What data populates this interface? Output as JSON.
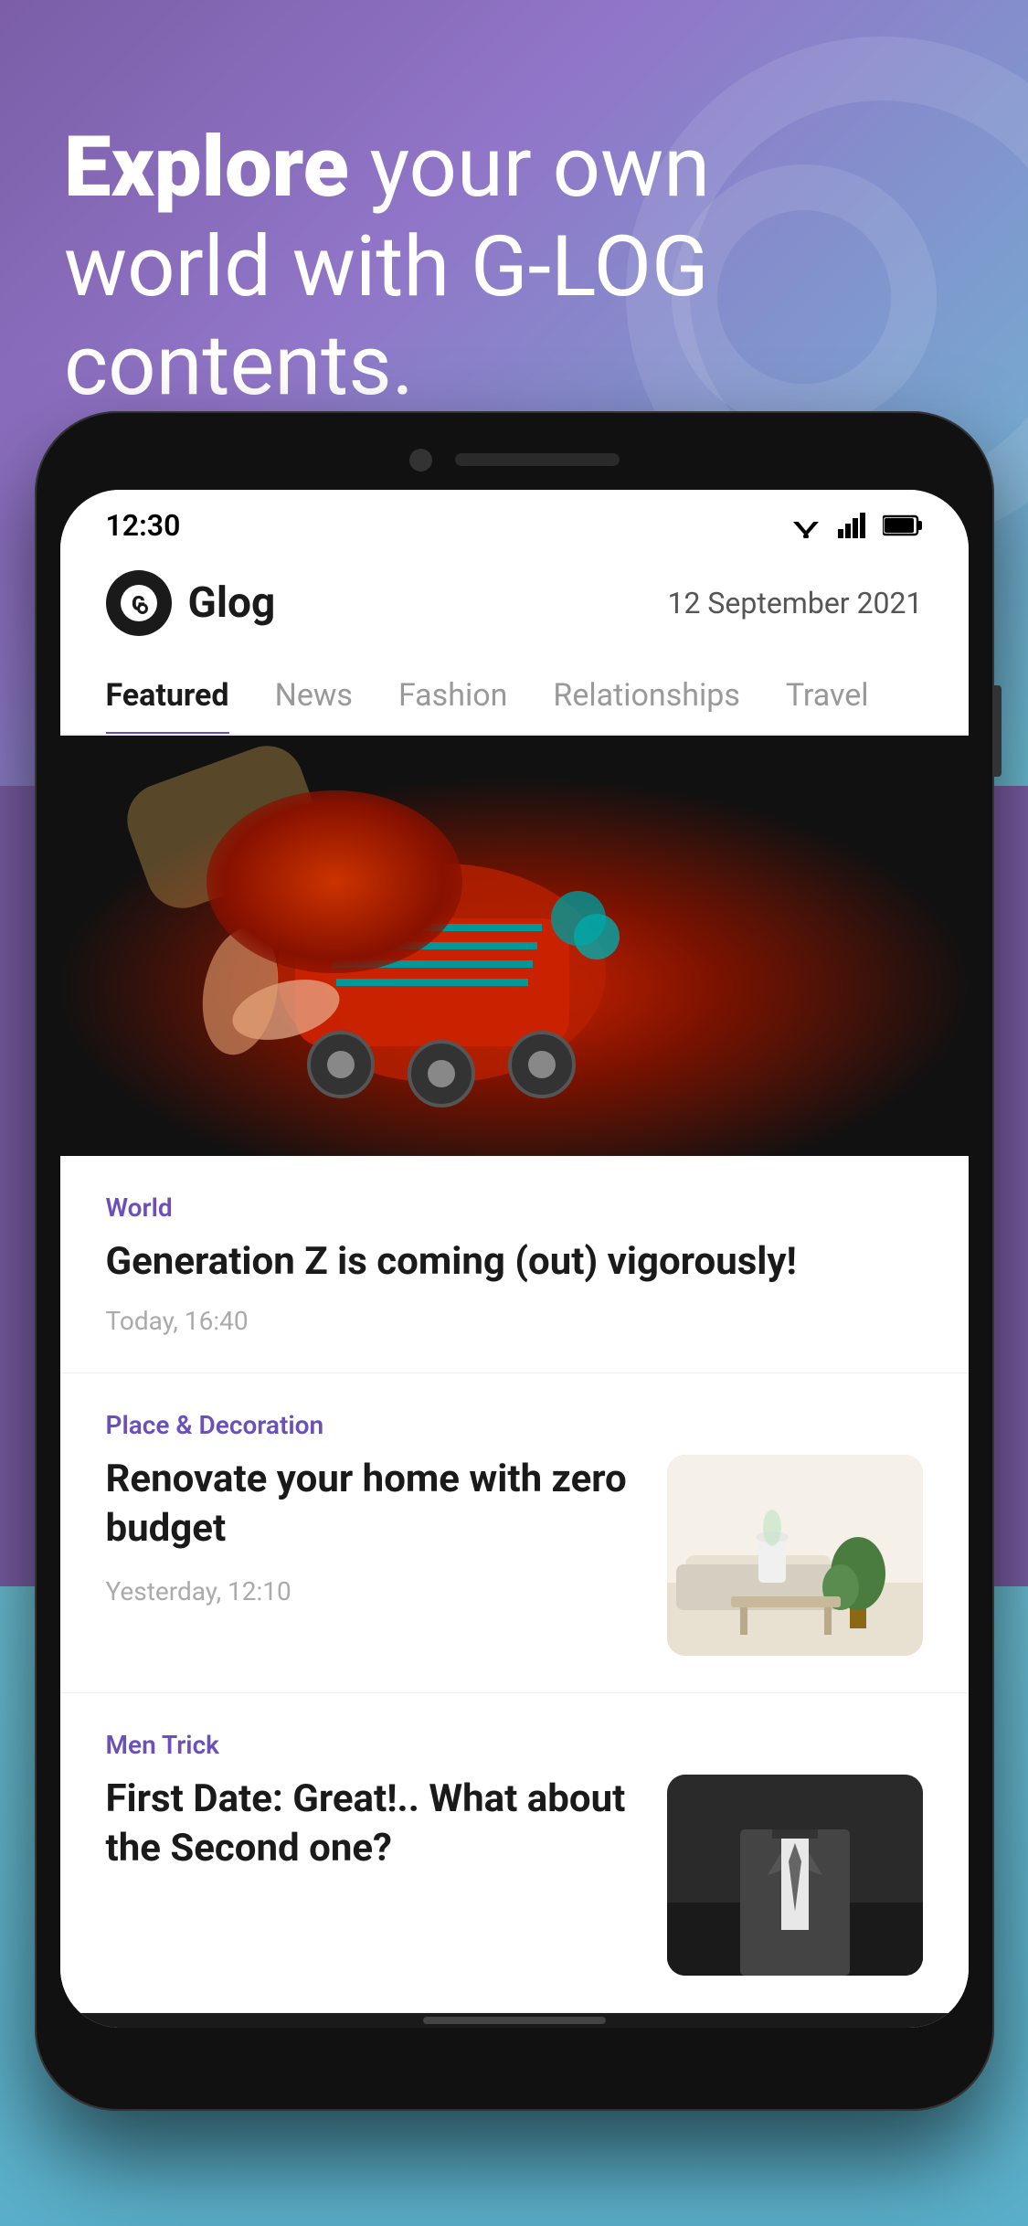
{
  "hero": {
    "headline_bold": "Explore",
    "headline_rest": " your own world with G-LOG contents.",
    "bg_color_start": "#7B5EA7",
    "bg_color_end": "#5BBCD4"
  },
  "status_bar": {
    "time": "12:30"
  },
  "app_header": {
    "logo_text": "Glog",
    "date": "12 September 2021"
  },
  "nav": {
    "tabs": [
      {
        "id": "featured",
        "label": "Featured",
        "active": true
      },
      {
        "id": "news",
        "label": "News",
        "active": false
      },
      {
        "id": "fashion",
        "label": "Fashion",
        "active": false
      },
      {
        "id": "relationships",
        "label": "Relationships",
        "active": false
      },
      {
        "id": "travel",
        "label": "Travel",
        "active": false
      }
    ]
  },
  "featured_article": {
    "category": "World",
    "title": "Generation Z is coming (out) vigorously!",
    "time": "Today, 16:40"
  },
  "article2": {
    "category": "Place & Decoration",
    "title": "Renovate your home with zero budget",
    "time": "Yesterday, 12:10"
  },
  "article3": {
    "category": "Men Trick",
    "title": "First Date: Great!.. What about the Second one?"
  },
  "icons": {
    "wifi": "▼",
    "signal": "▲",
    "battery": "▮"
  }
}
